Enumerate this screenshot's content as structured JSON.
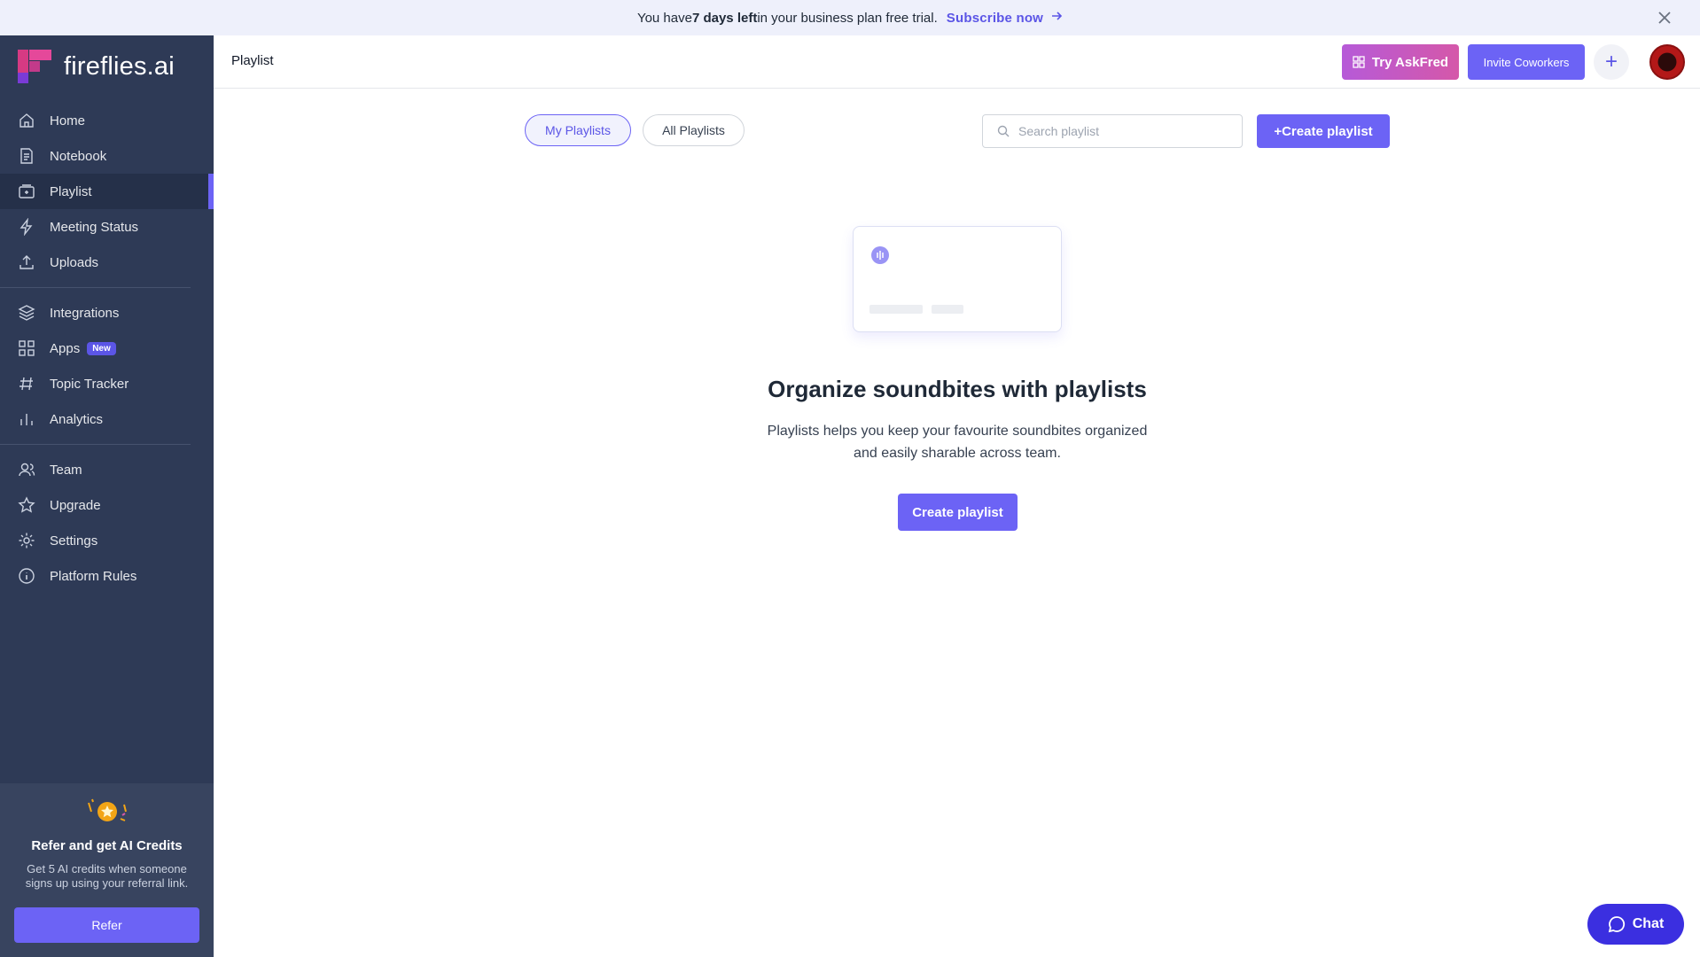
{
  "banner": {
    "prefix": "You have ",
    "bold": "7 days left",
    "suffix": " in your business plan free trial.",
    "link": "Subscribe now"
  },
  "brand": {
    "name": "fireflies.ai"
  },
  "sidebar": {
    "group1": [
      {
        "label": "Home",
        "icon": "home-icon"
      },
      {
        "label": "Notebook",
        "icon": "notebook-icon"
      },
      {
        "label": "Playlist",
        "icon": "playlist-icon",
        "active": true
      },
      {
        "label": "Meeting Status",
        "icon": "bolt-icon"
      },
      {
        "label": "Uploads",
        "icon": "upload-icon"
      }
    ],
    "group2": [
      {
        "label": "Integrations",
        "icon": "layers-icon"
      },
      {
        "label": "Apps",
        "icon": "grid-icon",
        "badge": "New"
      },
      {
        "label": "Topic Tracker",
        "icon": "hash-icon"
      },
      {
        "label": "Analytics",
        "icon": "bar-chart-icon"
      }
    ],
    "group3": [
      {
        "label": "Team",
        "icon": "users-icon"
      },
      {
        "label": "Upgrade",
        "icon": "star-icon"
      },
      {
        "label": "Settings",
        "icon": "gear-icon"
      },
      {
        "label": "Platform Rules",
        "icon": "info-icon"
      }
    ],
    "refer": {
      "title": "Refer and get AI Credits",
      "desc": "Get 5 AI credits when someone signs up using your referral link.",
      "button": "Refer"
    }
  },
  "header": {
    "title": "Playlist",
    "askfred": "Try AskFred",
    "invite": "Invite Coworkers",
    "plus": "+"
  },
  "main": {
    "tabs": [
      "My Playlists",
      "All Playlists"
    ],
    "search_placeholder": "Search playlist",
    "create_top": "+Create playlist",
    "empty_title": "Organize soundbites with playlists",
    "empty_desc_line1": "Playlists helps you keep your favourite soundbites organized",
    "empty_desc_line2": "and easily sharable across team.",
    "create_button": "Create playlist"
  },
  "chat": {
    "label": "Chat"
  },
  "colors": {
    "accent": "#6c63f5",
    "sidebar": "#2e3a56",
    "banner": "#eef0fb"
  }
}
